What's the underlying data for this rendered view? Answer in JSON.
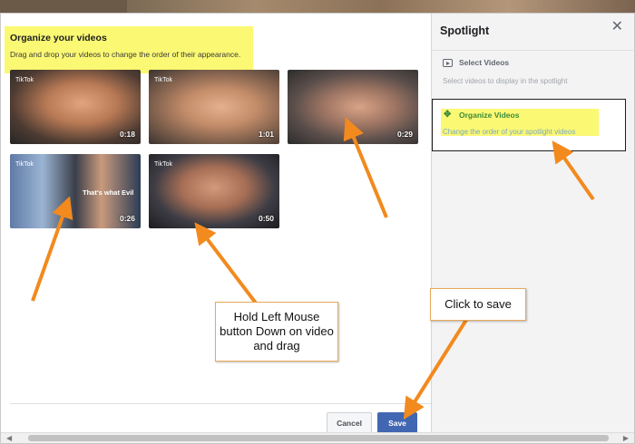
{
  "main": {
    "title": "Organize your videos",
    "subtitle": "Drag and drop your videos to change the order of their appearance.",
    "videos": [
      {
        "duration": "0:18",
        "brand": "TikTok"
      },
      {
        "duration": "1:01",
        "brand": "TikTok"
      },
      {
        "duration": "0:29",
        "brand": ""
      },
      {
        "duration": "0:26",
        "brand": "TikTok",
        "caption": "That's what Evil"
      },
      {
        "duration": "0:50",
        "brand": "TikTok"
      }
    ],
    "cancel_label": "Cancel",
    "save_label": "Save"
  },
  "sidebar": {
    "title": "Spotlight",
    "close_icon": "close-icon",
    "select_videos": {
      "title": "Select Videos",
      "subtitle": "Select videos to display in the spotlight",
      "icon": "video-icon"
    },
    "organize_videos": {
      "title": "Organize Videos",
      "subtitle": "Change the order of your spotlight videos",
      "icon": "move-icon"
    }
  },
  "annotations": {
    "drag_note": "Hold Left Mouse button Down on video and drag",
    "save_note": "Click to save",
    "arrow_color": "#f28a1e",
    "highlight_color": "#fbf873"
  }
}
